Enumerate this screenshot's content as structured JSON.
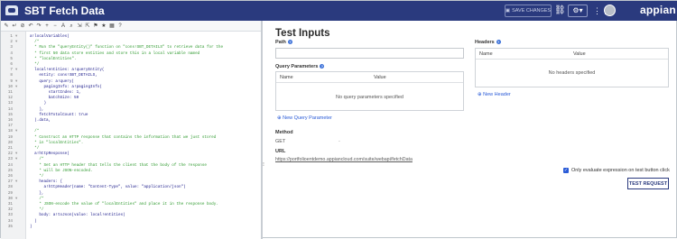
{
  "header": {
    "title": "SBT Fetch Data",
    "save_label": "SAVE CHANGES",
    "brand": "appian",
    "bg_color": "#2a3a7e"
  },
  "editor": {
    "toolbar_icons": [
      "format-icon",
      "wrap-icon",
      "comment-icon",
      "undo-icon",
      "redo-icon",
      "zoom-in-icon",
      "zoom-out-icon",
      "font-icon",
      "search-icon",
      "expand-icon",
      "collapse-icon",
      "bookmark-icon",
      "star-icon",
      "grid-icon",
      "help-icon"
    ],
    "lines": [
      {
        "n": "1",
        "text": "a!localVariables(",
        "cls": ""
      },
      {
        "n": "2",
        "text": "  /*",
        "cls": "c-cm"
      },
      {
        "n": "3",
        "text": "  * Run the \"queryEntity()\" function on \"cons!SBT_DETAILS\" to retrieve data for the",
        "cls": "c-cm"
      },
      {
        "n": "4",
        "text": "  * first 50 data store entities and store this in a local variable named",
        "cls": "c-cm"
      },
      {
        "n": "5",
        "text": "  * \"localEntities\".",
        "cls": "c-cm"
      },
      {
        "n": "6",
        "text": "  */",
        "cls": "c-cm"
      },
      {
        "n": "7",
        "text": "  local!entities: a!queryEntity(",
        "cls": ""
      },
      {
        "n": "8",
        "text": "    entity: cons!SBT_DETAILS,",
        "cls": ""
      },
      {
        "n": "9",
        "text": "    query: a!query(",
        "cls": ""
      },
      {
        "n": "10",
        "text": "      pagingInfo: a!pagingInfo(",
        "cls": ""
      },
      {
        "n": "11",
        "text": "        startIndex: 1,",
        "cls": ""
      },
      {
        "n": "12",
        "text": "        batchSize: 50",
        "cls": ""
      },
      {
        "n": "13",
        "text": "      )",
        "cls": ""
      },
      {
        "n": "14",
        "text": "    ),",
        "cls": ""
      },
      {
        "n": "15",
        "text": "    fetchTotalCount: true",
        "cls": ""
      },
      {
        "n": "16",
        "text": "  ).data,",
        "cls": ""
      },
      {
        "n": "17",
        "text": "",
        "cls": ""
      },
      {
        "n": "18",
        "text": "  /*",
        "cls": "c-cm"
      },
      {
        "n": "19",
        "text": "  * Construct an HTTP response that contains the information that we just stored",
        "cls": "c-cm"
      },
      {
        "n": "20",
        "text": "  * in \"localEntities\".",
        "cls": "c-cm"
      },
      {
        "n": "21",
        "text": "  */",
        "cls": "c-cm"
      },
      {
        "n": "22",
        "text": "  a!httpResponse(",
        "cls": ""
      },
      {
        "n": "23",
        "text": "    /*",
        "cls": "c-cm"
      },
      {
        "n": "24",
        "text": "    * Set an HTTP header that tells the client that the body of the response",
        "cls": "c-cm"
      },
      {
        "n": "25",
        "text": "    * will be JSON-encoded.",
        "cls": "c-cm"
      },
      {
        "n": "26",
        "text": "    */",
        "cls": "c-cm"
      },
      {
        "n": "27",
        "text": "    headers: {",
        "cls": ""
      },
      {
        "n": "28",
        "text": "      a!httpHeader(name: \"Content-Type\", value: \"application/json\")",
        "cls": ""
      },
      {
        "n": "29",
        "text": "    },",
        "cls": ""
      },
      {
        "n": "30",
        "text": "    /*",
        "cls": "c-cm"
      },
      {
        "n": "31",
        "text": "    * JSON-encode the value of \"localEntities\" and place it in the response body.",
        "cls": "c-cm"
      },
      {
        "n": "32",
        "text": "    */",
        "cls": "c-cm"
      },
      {
        "n": "33",
        "text": "    body: a!toJson(value: local!entities)",
        "cls": ""
      },
      {
        "n": "34",
        "text": "  )",
        "cls": ""
      },
      {
        "n": "35",
        "text": ")",
        "cls": ""
      }
    ]
  },
  "test_inputs": {
    "title": "Test Inputs",
    "path_label": "Path",
    "path_value": "",
    "query_params_label": "Query Parameters",
    "qp_columns": [
      "Name",
      "Value"
    ],
    "qp_empty": "No query parameters specified",
    "new_qp_label": "New Query Parameter",
    "headers_label": "Headers",
    "hd_columns": [
      "Name",
      "Value"
    ],
    "hd_empty": "No headers specified",
    "new_header_label": "New Header",
    "method_label": "Method",
    "method_value": "GET",
    "url_label": "URL",
    "url_value": "https://portfolioentdemo.appiancloud.com/suite/webapi/fetchData",
    "checkbox_label": "Only evaluate expression on test button click",
    "checkbox_checked": true,
    "test_button_label": "TEST REQUEST"
  }
}
